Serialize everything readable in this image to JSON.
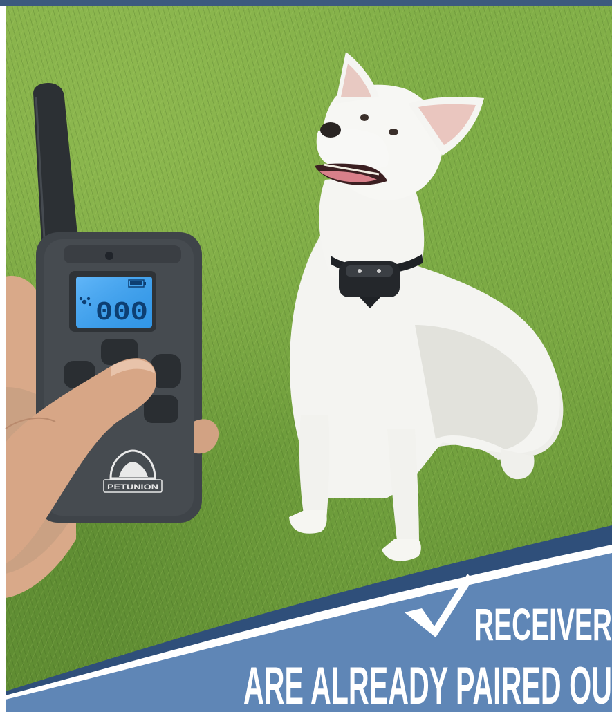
{
  "banner": {
    "line1": "RECEIVER",
    "line2": "ARE ALREADY PAIRED OU"
  },
  "remote": {
    "display_value": "000",
    "brand": "PETUNION"
  },
  "colors": {
    "grass": "#7aa742",
    "banner_blue": "#5f86b6",
    "banner_dark": "#2f4f7a",
    "lcd_blue": "#3aa0f0",
    "remote_body": "#3f4449"
  },
  "icons": [
    "checkmark-icon",
    "petunion-logo-icon",
    "paw-icon",
    "battery-icon"
  ]
}
